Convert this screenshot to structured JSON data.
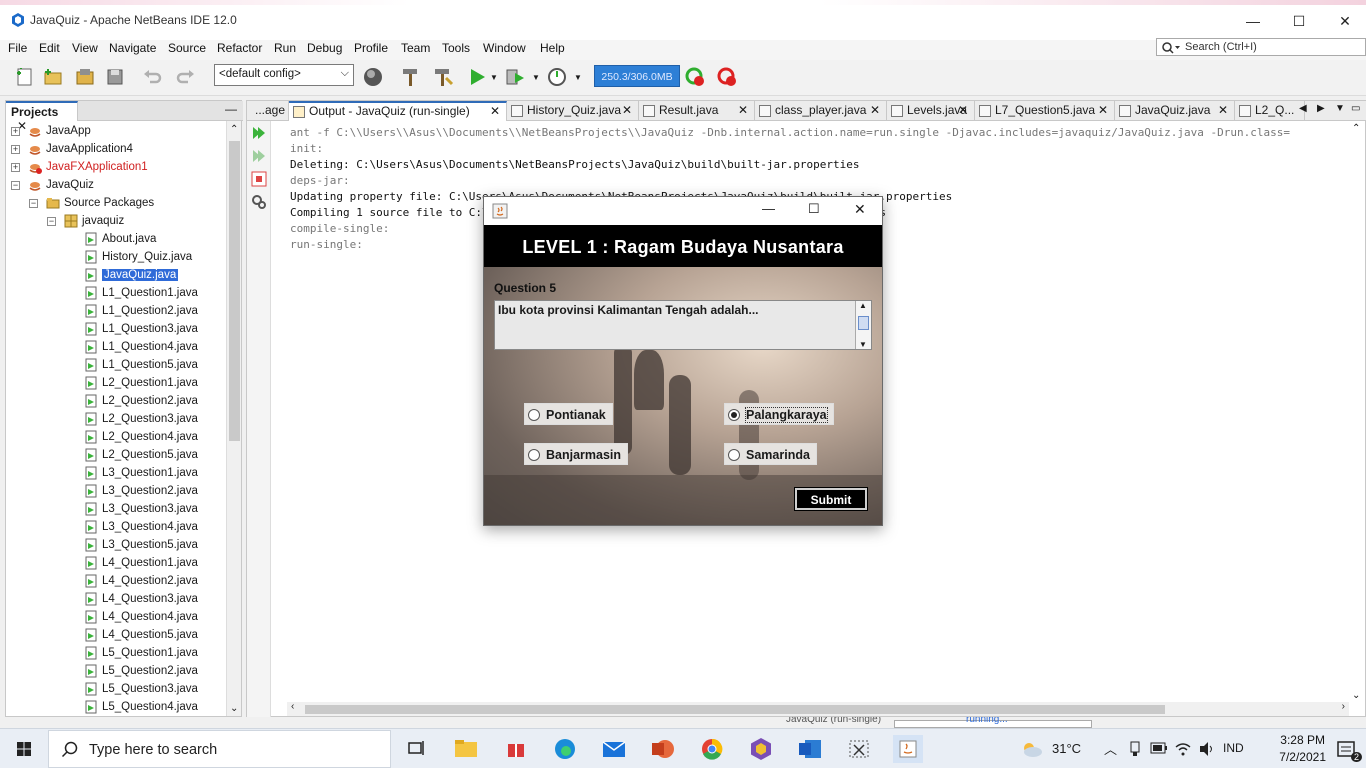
{
  "window": {
    "title": "JavaQuiz - Apache NetBeans IDE 12.0",
    "minimize": "—",
    "maximize": "☐",
    "close": "✕"
  },
  "menu": [
    "File",
    "Edit",
    "View",
    "Navigate",
    "Source",
    "Refactor",
    "Run",
    "Debug",
    "Profile",
    "Team",
    "Tools",
    "Window",
    "Help"
  ],
  "search": {
    "placeholder": "Search (Ctrl+I)"
  },
  "toolbar": {
    "config": "<default config>",
    "memory": "250.3/306.0MB"
  },
  "projects": {
    "tab_label": "Projects",
    "minimize": "—",
    "items": [
      {
        "label": "JavaApp",
        "level": 0,
        "type": "project"
      },
      {
        "label": "JavaApplication4",
        "level": 0,
        "type": "project"
      },
      {
        "label": "JavaFXApplication1",
        "level": 0,
        "type": "project-error"
      },
      {
        "label": "JavaQuiz",
        "level": 0,
        "type": "project"
      },
      {
        "label": "Source Packages",
        "level": 1,
        "type": "folder"
      },
      {
        "label": "javaquiz",
        "level": 2,
        "type": "package"
      },
      {
        "label": "About.java",
        "level": 3,
        "type": "file"
      },
      {
        "label": "History_Quiz.java",
        "level": 3,
        "type": "file"
      },
      {
        "label": "JavaQuiz.java",
        "level": 3,
        "type": "file",
        "selected": true
      },
      {
        "label": "L1_Question1.java",
        "level": 3,
        "type": "file"
      },
      {
        "label": "L1_Question2.java",
        "level": 3,
        "type": "file"
      },
      {
        "label": "L1_Question3.java",
        "level": 3,
        "type": "file"
      },
      {
        "label": "L1_Question4.java",
        "level": 3,
        "type": "file"
      },
      {
        "label": "L1_Question5.java",
        "level": 3,
        "type": "file"
      },
      {
        "label": "L2_Question1.java",
        "level": 3,
        "type": "file"
      },
      {
        "label": "L2_Question2.java",
        "level": 3,
        "type": "file"
      },
      {
        "label": "L2_Question3.java",
        "level": 3,
        "type": "file"
      },
      {
        "label": "L2_Question4.java",
        "level": 3,
        "type": "file"
      },
      {
        "label": "L2_Question5.java",
        "level": 3,
        "type": "file"
      },
      {
        "label": "L3_Question1.java",
        "level": 3,
        "type": "file"
      },
      {
        "label": "L3_Question2.java",
        "level": 3,
        "type": "file"
      },
      {
        "label": "L3_Question3.java",
        "level": 3,
        "type": "file"
      },
      {
        "label": "L3_Question4.java",
        "level": 3,
        "type": "file"
      },
      {
        "label": "L3_Question5.java",
        "level": 3,
        "type": "file"
      },
      {
        "label": "L4_Question1.java",
        "level": 3,
        "type": "file"
      },
      {
        "label": "L4_Question2.java",
        "level": 3,
        "type": "file"
      },
      {
        "label": "L4_Question3.java",
        "level": 3,
        "type": "file"
      },
      {
        "label": "L4_Question4.java",
        "level": 3,
        "type": "file"
      },
      {
        "label": "L4_Question5.java",
        "level": 3,
        "type": "file"
      },
      {
        "label": "L5_Question1.java",
        "level": 3,
        "type": "file"
      },
      {
        "label": "L5_Question2.java",
        "level": 3,
        "type": "file"
      },
      {
        "label": "L5_Question3.java",
        "level": 3,
        "type": "file"
      },
      {
        "label": "L5_Question4.java",
        "level": 3,
        "type": "file"
      }
    ]
  },
  "editor_tabs": [
    {
      "label": "...age",
      "active": false
    },
    {
      "label": "Output - JavaQuiz (run-single)",
      "active": true
    },
    {
      "label": "History_Quiz.java",
      "active": false
    },
    {
      "label": "Result.java",
      "active": false
    },
    {
      "label": "class_player.java",
      "active": false
    },
    {
      "label": "Levels.java",
      "active": false
    },
    {
      "label": "L7_Question5.java",
      "active": false
    },
    {
      "label": "JavaQuiz.java",
      "active": false
    },
    {
      "label": "L2_Q...",
      "active": false
    }
  ],
  "output_lines": [
    {
      "text": "ant -f C:\\\\Users\\\\Asus\\\\Documents\\\\NetBeansProjects\\\\JavaQuiz -Dnb.internal.action.name=run.single -Djavac.includes=javaquiz/JavaQuiz.java -Drun.class=",
      "gray": true
    },
    {
      "text": "init:",
      "gray": true
    },
    {
      "text": "Deleting: C:\\Users\\Asus\\Documents\\NetBeansProjects\\JavaQuiz\\build\\built-jar.properties",
      "gray": false
    },
    {
      "text": "deps-jar:",
      "gray": true
    },
    {
      "text": "Updating property file: C:\\Users\\Asus\\Documents\\NetBeansProjects\\JavaQuiz\\build\\built-jar.properties",
      "gray": false
    },
    {
      "text": "Compiling 1 source file to C:\\Users\\Asus\\Documents\\NetBeansProjects\\JavaQuiz\\build\\classes",
      "gray": false
    },
    {
      "text": "compile-single:",
      "gray": true
    },
    {
      "text": "run-single:",
      "gray": true
    }
  ],
  "status": {
    "task": "JavaQuiz (run-single)",
    "state": "running..."
  },
  "dialog": {
    "header": "LEVEL 1 :  Ragam Budaya Nusantara",
    "question_label": "Question 5",
    "question_text": "Ibu kota provinsi Kalimantan Tengah adalah...",
    "options": [
      {
        "label": "Pontianak",
        "selected": false
      },
      {
        "label": "Palangkaraya",
        "selected": true
      },
      {
        "label": "Banjarmasin",
        "selected": false
      },
      {
        "label": "Samarinda",
        "selected": false
      }
    ],
    "submit": "Submit"
  },
  "taskbar": {
    "search_placeholder": "Type here to search",
    "weather": "31°C",
    "language": "IND",
    "time": "3:28 PM",
    "date": "7/2/2021",
    "notification_count": "2"
  }
}
